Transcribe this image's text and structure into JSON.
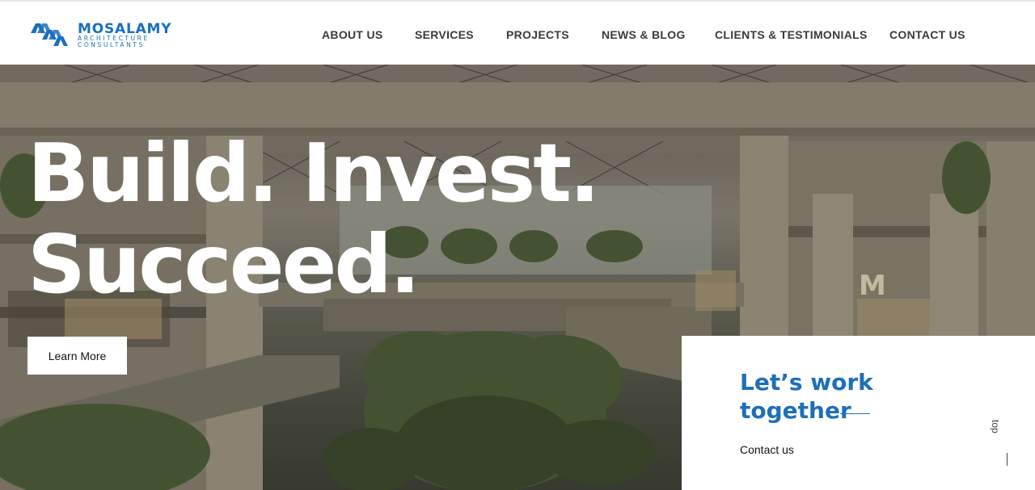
{
  "brand": {
    "name": "MOSALAMY",
    "line1": "ARCHITECTURE",
    "line2": "CONSULTANTS",
    "color": "#1a6fc0",
    "icon": "mosalamy-logo-mark"
  },
  "nav": {
    "items": [
      {
        "label": "ABOUT US"
      },
      {
        "label": "SERVICES"
      },
      {
        "label": "PROJECTS"
      },
      {
        "label": "NEWS & BLOG"
      },
      {
        "label": "CLIENTS & TESTIMONIALS"
      },
      {
        "label": "CONTACT US"
      }
    ]
  },
  "hero": {
    "headline_line1": "Build. Invest.",
    "headline_line2": "Succeed.",
    "cta_label": "Learn More"
  },
  "card": {
    "title_line1": "Let’s work",
    "title_line2": "together",
    "link_label": "Contact us",
    "accent": "#1d6fb8"
  },
  "scroll_top": {
    "label": "top"
  }
}
